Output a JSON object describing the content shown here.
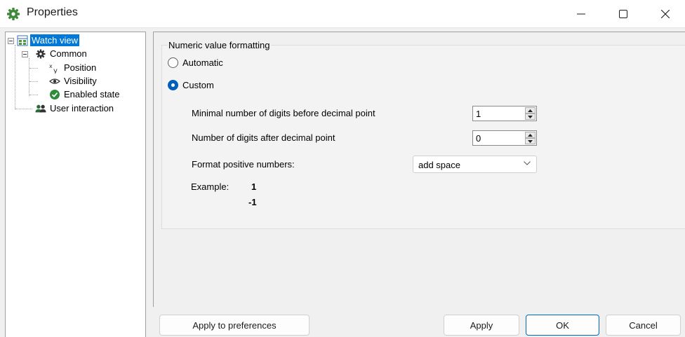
{
  "window": {
    "title": "Properties",
    "accent_color": "#0078d7"
  },
  "tree": {
    "items": [
      {
        "label": "Watch view",
        "icon": "watch-view-icon",
        "selected": true
      },
      {
        "label": "Common",
        "icon": "gear-icon"
      },
      {
        "label": "Position",
        "icon": "xy-position-icon"
      },
      {
        "label": "Visibility",
        "icon": "eye-icon"
      },
      {
        "label": "Enabled state",
        "icon": "check-circle-icon"
      },
      {
        "label": "User interaction",
        "icon": "users-icon"
      }
    ]
  },
  "formatting": {
    "group_title": "Numeric value formatting",
    "options": [
      {
        "label": "Automatic",
        "checked": false
      },
      {
        "label": "Custom",
        "checked": true
      }
    ],
    "digits_before_label": "Minimal number of digits before decimal point",
    "digits_before_value": "1",
    "digits_after_label": "Number of digits after decimal point",
    "digits_after_value": "0",
    "positive_label": "Format positive numbers:",
    "positive_value": "add space",
    "example_label": "Example:",
    "example_positive": "1",
    "example_negative": "-1"
  },
  "buttons": {
    "apply_prefs": "Apply to preferences",
    "apply": "Apply",
    "ok": "OK",
    "cancel": "Cancel"
  }
}
